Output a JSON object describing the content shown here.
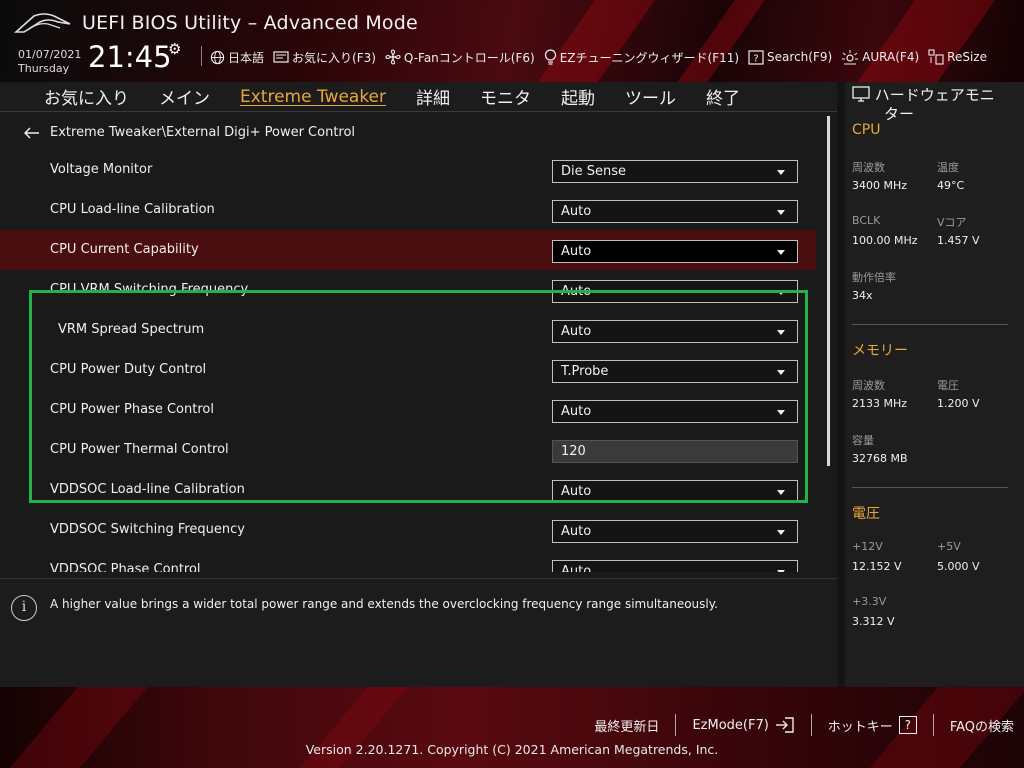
{
  "header": {
    "title": "UEFI BIOS Utility – Advanced Mode",
    "date": "01/07/2021",
    "weekday": "Thursday",
    "time": "21:45",
    "toolbar": [
      {
        "icon": "globe-icon",
        "label": "日本語"
      },
      {
        "icon": "favorites-icon",
        "label": "お気に入り(F3)"
      },
      {
        "icon": "fan-icon",
        "label": "Q-Fanコントロール(F6)"
      },
      {
        "icon": "bulb-icon",
        "label": "EZチューニングウィザード(F11)"
      },
      {
        "icon": "search-icon",
        "label": "Search(F9)"
      },
      {
        "icon": "aura-icon",
        "label": "AURA(F4)"
      },
      {
        "icon": "resize-icon",
        "label": "ReSize"
      }
    ]
  },
  "tabs": [
    "お気に入り",
    "メイン",
    "Extreme Tweaker",
    "詳細",
    "モニタ",
    "起動",
    "ツール",
    "終了"
  ],
  "active_tab": "Extreme Tweaker",
  "breadcrumb": "Extreme Tweaker\\External Digi+ Power Control",
  "settings": [
    {
      "label": "Voltage Monitor",
      "value": "Die Sense",
      "type": "select"
    },
    {
      "label": "CPU Load-line Calibration",
      "value": "Auto",
      "type": "select"
    },
    {
      "label": "CPU Current Capability",
      "value": "Auto",
      "type": "select",
      "selected": true
    },
    {
      "label": "CPU VRM Switching Frequency",
      "value": "Auto",
      "type": "select"
    },
    {
      "label": "VRM Spread Spectrum",
      "value": "Auto",
      "type": "select",
      "indent": true
    },
    {
      "label": "CPU Power Duty Control",
      "value": "T.Probe",
      "type": "select"
    },
    {
      "label": "CPU Power Phase Control",
      "value": "Auto",
      "type": "select"
    },
    {
      "label": "CPU Power Thermal Control",
      "value": "120",
      "type": "text"
    },
    {
      "label": "VDDSOC Load-line Calibration",
      "value": "Auto",
      "type": "select"
    },
    {
      "label": "VDDSOC Switching Frequency",
      "value": "Auto",
      "type": "select"
    },
    {
      "label": "VDDSOC Phase Control",
      "value": "Auto",
      "type": "select"
    }
  ],
  "info_text": "A higher value brings a wider total power range and extends the overclocking frequency range simultaneously.",
  "hw_monitor": {
    "title_line1": "ハードウェアモニ",
    "title_line2": "ター",
    "cpu": {
      "section": "CPU",
      "freq_label": "周波数",
      "freq": "3400 MHz",
      "temp_label": "温度",
      "temp": "49°C",
      "bclk_label": "BCLK",
      "bclk": "100.00 MHz",
      "vcore_label": "Vコア",
      "vcore": "1.457 V",
      "ratio_label": "動作倍率",
      "ratio": "34x"
    },
    "memory": {
      "section": "メモリー",
      "freq_label": "周波数",
      "freq": "2133 MHz",
      "volt_label": "電圧",
      "volt": "1.200 V",
      "cap_label": "容量",
      "cap": "32768 MB"
    },
    "voltage": {
      "section": "電圧",
      "v12_label": "+12V",
      "v12": "12.152 V",
      "v5_label": "+5V",
      "v5": "5.000 V",
      "v33_label": "+3.3V",
      "v33": "3.312 V"
    }
  },
  "footer": {
    "last_modified": "最終更新日",
    "ezmode": "EzMode(F7)",
    "hotkeys": "ホットキー",
    "hotkeys_key": "?",
    "faq": "FAQの検索",
    "copyright": "Version 2.20.1271. Copyright (C) 2021 American Megatrends, Inc."
  },
  "colors": {
    "accent": "#e7a83a",
    "highlight_border": "#22b24c",
    "selected_row": "#4a0d10"
  }
}
